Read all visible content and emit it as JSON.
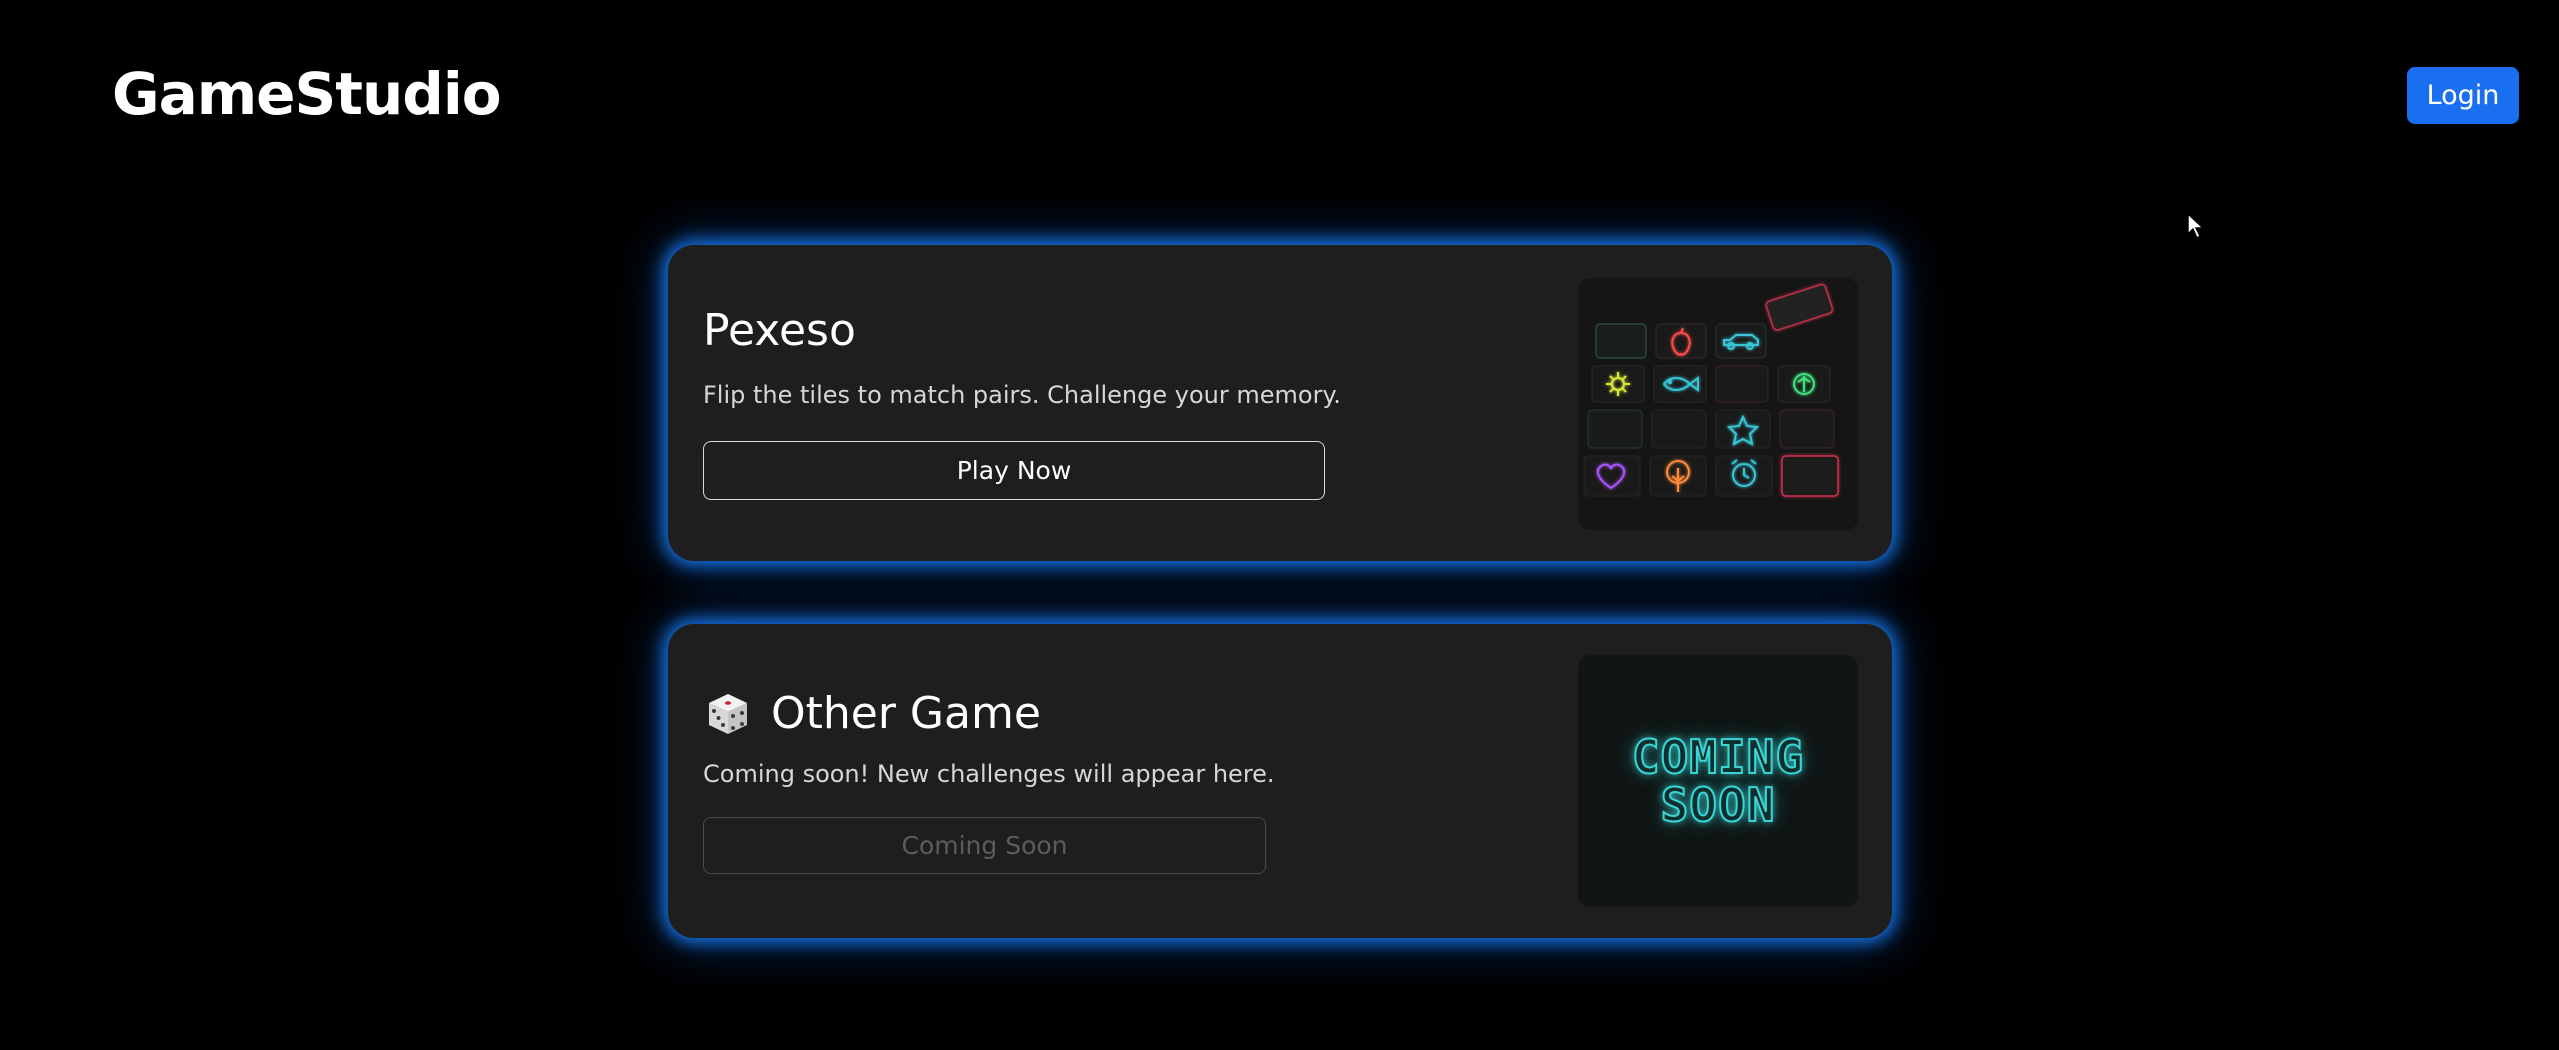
{
  "header": {
    "brand": "GameStudio",
    "login_label": "Login",
    "login_color": "#1a6ff0"
  },
  "games": [
    {
      "title": "Pexeso",
      "description": "Flip the tiles to match pairs. Challenge your memory.",
      "button_label": "Play Now",
      "thumbnail": "memory-tiles-neon-grid"
    },
    {
      "icon": "dice-icon",
      "title": "Other Game",
      "description": "Coming soon! New challenges will appear here.",
      "button_label": "Coming Soon",
      "thumbnail_text": [
        "COMING",
        "SOON"
      ]
    }
  ],
  "theme": {
    "background": "#000000",
    "card_background": "#1e1e1e",
    "glow": "#1880ff",
    "neon_cyan": "#3ad6d6"
  }
}
